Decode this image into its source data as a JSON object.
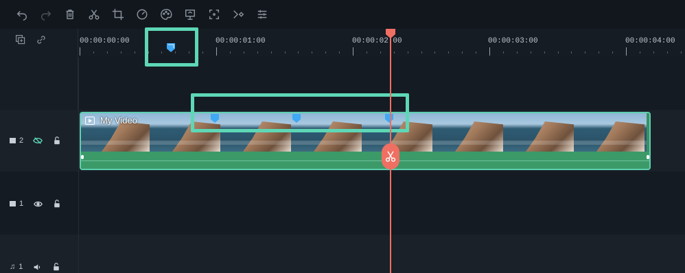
{
  "toolbar": {
    "buttons": [
      {
        "icon": "undo-icon"
      },
      {
        "icon": "redo-icon"
      },
      {
        "icon": "trash-icon"
      },
      {
        "icon": "scissors-icon"
      },
      {
        "icon": "crop-icon"
      },
      {
        "icon": "speed-icon"
      },
      {
        "icon": "color-palette-icon"
      },
      {
        "icon": "presentation-icon"
      },
      {
        "icon": "fit-frame-icon"
      },
      {
        "icon": "keyframe-icon"
      },
      {
        "icon": "adjust-icon"
      }
    ]
  },
  "header": {
    "add_track_icon": "add-track-icon",
    "link_icon": "link-icon"
  },
  "ruler": {
    "labels": [
      "00:00:00:00",
      "00:00:01:00",
      "00:00:02:00",
      "00:00:03:00",
      "00:00:04:00"
    ]
  },
  "playhead": {
    "time": "00:00:02:00"
  },
  "tracks": [
    {
      "type": "video",
      "index": "2",
      "visibility_icon": "eye-off-icon",
      "lock_icon": "unlock-icon"
    },
    {
      "type": "video",
      "index": "1",
      "visibility_icon": "eye-icon",
      "lock_icon": "unlock-icon"
    },
    {
      "type": "audio",
      "index": "1",
      "visibility_icon": "volume-icon",
      "lock_icon": "unlock-icon"
    }
  ],
  "clip": {
    "title": "My Video",
    "track": "2"
  },
  "markers": {
    "ruler_marker_color": "#3fa9f5",
    "clip_marker_count": 3
  },
  "colors": {
    "accent": "#5ed7b6",
    "playhead": "#ef6f63",
    "clip_fill": "#3c9a69"
  }
}
